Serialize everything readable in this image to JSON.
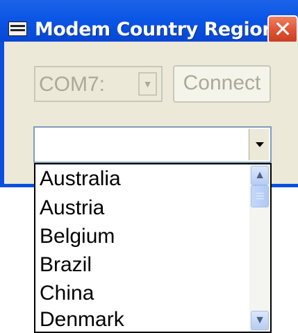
{
  "window": {
    "title": "Modem Country Region",
    "icon": "window-app-icon",
    "close_icon": "close-x-icon",
    "close_glyph": "✕"
  },
  "port_combo": {
    "value": "COM7:",
    "disabled": true
  },
  "connect_button": {
    "label": "Connect",
    "disabled": true
  },
  "region_combo": {
    "value": "",
    "options_visible": [
      "Australia",
      "Austria",
      "Belgium",
      "Brazil",
      "China",
      "Denmark"
    ]
  },
  "scrollbar": {
    "up_icon": "chevron-up-icon",
    "down_icon": "chevron-down-icon",
    "up_glyph": "▲",
    "down_glyph": "▼"
  },
  "colors": {
    "titlebar": "#0b56e6",
    "client_bg": "#ece9d8",
    "close_button": "#e0553a",
    "disabled_text": "#aca899"
  }
}
